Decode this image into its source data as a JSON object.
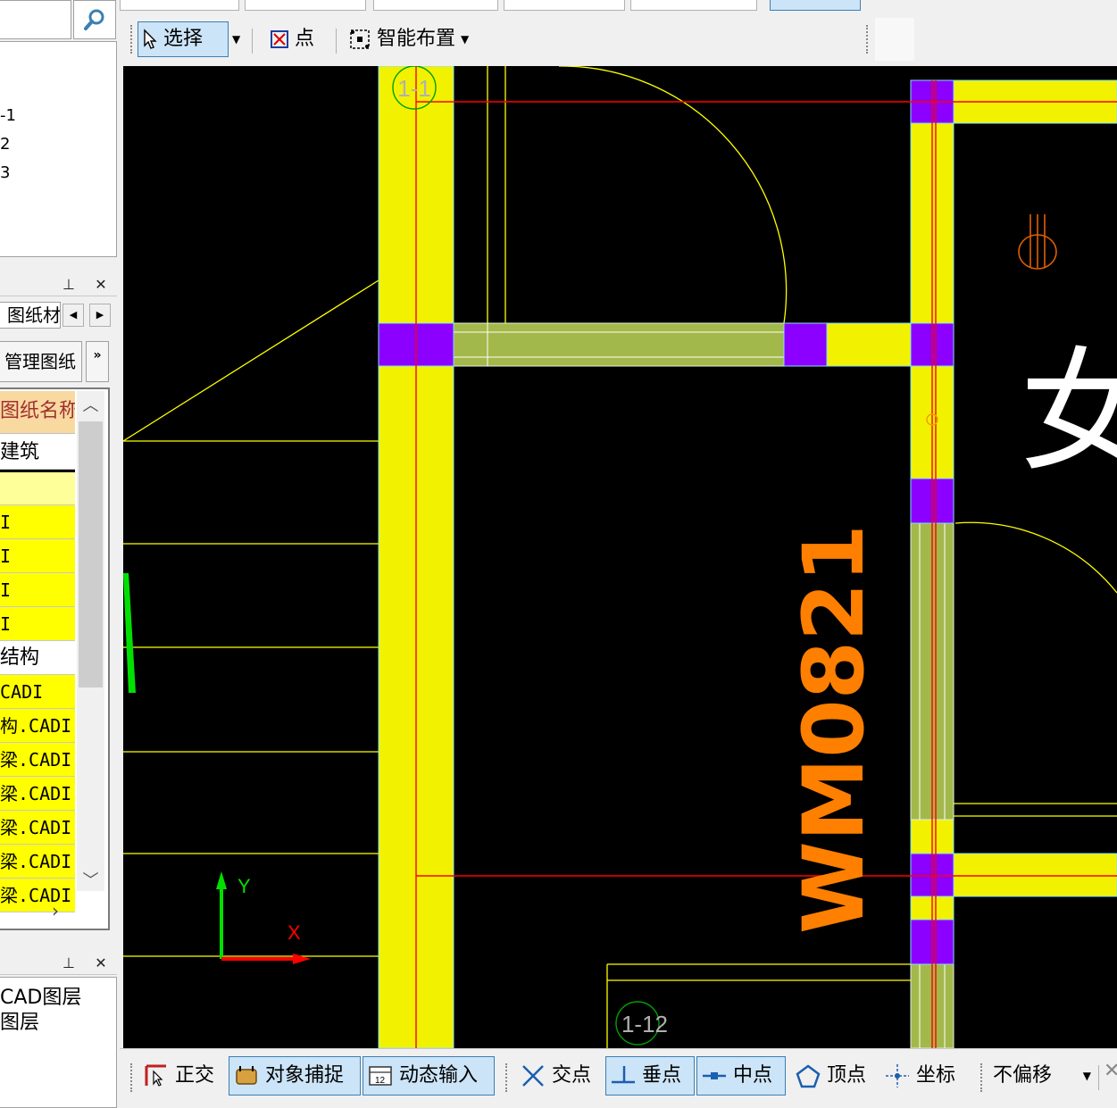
{
  "floor_list": {
    "items": [
      "-1",
      "2",
      "3"
    ]
  },
  "drawing_panel": {
    "pin_icon": "pin-icon",
    "close_icon": "close-icon",
    "tab_label": "图纸材",
    "manage_label": "管理图纸",
    "more_label": "»",
    "table": {
      "header": "图纸名称",
      "rows": [
        {
          "text": "建筑",
          "style": "white"
        },
        {
          "text": "",
          "style": "sel"
        },
        {
          "text": "I",
          "style": "yellow"
        },
        {
          "text": "I",
          "style": "yellow"
        },
        {
          "text": "I",
          "style": "yellow"
        },
        {
          "text": "I",
          "style": "yellow"
        },
        {
          "text": "结构",
          "style": "white"
        },
        {
          "text": "CADI",
          "style": "yellow"
        },
        {
          "text": "构.CADI",
          "style": "yellow"
        },
        {
          "text": "梁.CADI",
          "style": "yellow"
        },
        {
          "text": "梁.CADI",
          "style": "yellow"
        },
        {
          "text": "梁.CADI",
          "style": "yellow"
        },
        {
          "text": "梁.CADI",
          "style": "yellow"
        },
        {
          "text": "梁.CADI",
          "style": "yellow"
        }
      ]
    }
  },
  "layer_panel": {
    "items": [
      "CAD图层",
      "图层"
    ]
  },
  "toolbar": {
    "select_label": "选择",
    "point_label": "点",
    "smart_layout_label": "智能布置"
  },
  "canvas": {
    "grid_label_top": "1-1",
    "grid_label_bottom": "1-12",
    "room_text": "女",
    "window_label": "WM0821",
    "axis_y": "Y",
    "axis_x": "X"
  },
  "statusbar": {
    "ortho_label": "正交",
    "snap_label": "对象捕捉",
    "dynamic_input_label": "动态输入",
    "intersection_label": "交点",
    "perpendicular_label": "垂点",
    "midpoint_label": "中点",
    "vertex_label": "顶点",
    "coordinate_label": "坐标",
    "offset_label": "不偏移"
  },
  "colors": {
    "wall": "#f2f200",
    "column": "#8b00ff",
    "beam": "#a3b84a",
    "axis_red": "#ff0000",
    "cad_yellow": "#ffff00",
    "label_orange": "#ff7f00"
  }
}
